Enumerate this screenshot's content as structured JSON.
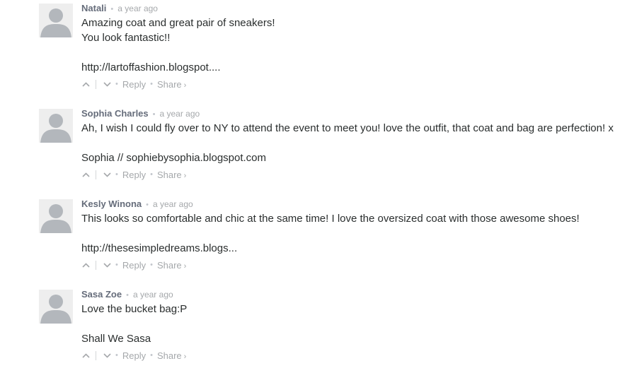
{
  "comments": [
    {
      "author": "Natali",
      "time": "a year ago",
      "paragraphs": [
        {
          "lines": [
            "Amazing coat and great pair of sneakers!",
            "You look fantastic!!"
          ]
        },
        {
          "link": "http://lartoffashion.blogspot...."
        }
      ],
      "actions": {
        "reply": "Reply",
        "share": "Share",
        "share_chevron": "›"
      }
    },
    {
      "author": "Sophia Charles",
      "time": "a year ago",
      "paragraphs": [
        {
          "lines": [
            "Ah, I wish I could fly over to NY to attend the event to meet you! love the outfit, that coat and bag are perfection! x"
          ]
        },
        {
          "prefix": "Sophia // ",
          "link": "sophiebysophia.blogspot.com"
        }
      ],
      "actions": {
        "reply": "Reply",
        "share": "Share",
        "share_chevron": "›"
      }
    },
    {
      "author": "Kesly Winona",
      "time": "a year ago",
      "paragraphs": [
        {
          "lines": [
            "This looks so comfortable and chic at the same time! I love the oversized coat with those awesome shoes!"
          ]
        },
        {
          "link": "http://thesesimpledreams.blogs..."
        }
      ],
      "actions": {
        "reply": "Reply",
        "share": "Share",
        "share_chevron": "›"
      }
    },
    {
      "author": "Sasa Zoe",
      "time": "a year ago",
      "paragraphs": [
        {
          "lines": [
            "Love the bucket bag:P"
          ]
        },
        {
          "link": "Shall We Sasa"
        }
      ],
      "actions": {
        "reply": "Reply",
        "share": "Share",
        "share_chevron": "›"
      }
    }
  ],
  "separator": "•",
  "icons": {
    "avatar": "default-avatar-icon",
    "upvote": "chevron-up-icon",
    "downvote": "chevron-down-icon"
  },
  "colors": {
    "author": "#656c7a",
    "meta": "#a5a8ab",
    "text": "#2a2e2e",
    "avatar_bg": "#eeeeee",
    "avatar_figure": "#b3b7bc"
  }
}
